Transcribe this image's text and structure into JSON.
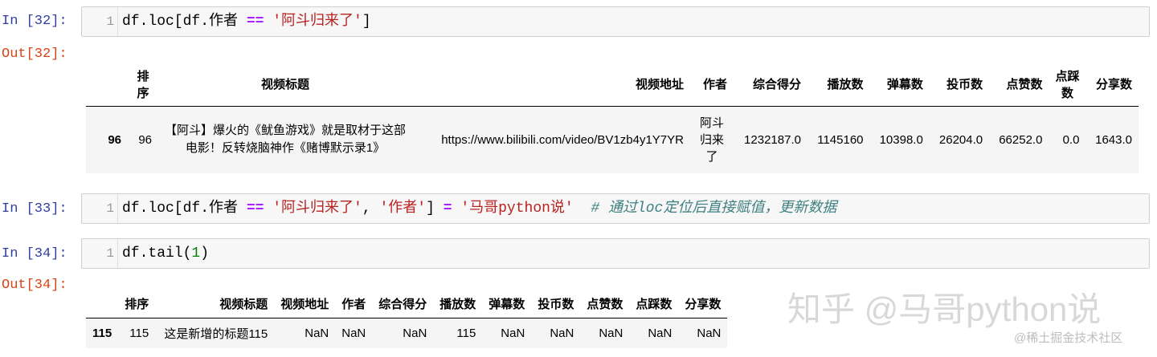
{
  "cells": [
    {
      "prompt": "In [32]:",
      "line": "1",
      "code": [
        {
          "t": "df.loc[df.作者 ",
          "c": ""
        },
        {
          "t": "==",
          "c": "op"
        },
        {
          "t": " ",
          "c": ""
        },
        {
          "t": "'阿斗归来了'",
          "c": "str"
        },
        {
          "t": "]",
          "c": ""
        }
      ]
    },
    {
      "prompt": "In [33]:",
      "line": "1",
      "code": [
        {
          "t": "df.loc[df.作者 ",
          "c": ""
        },
        {
          "t": "==",
          "c": "op"
        },
        {
          "t": " ",
          "c": ""
        },
        {
          "t": "'阿斗归来了'",
          "c": "str"
        },
        {
          "t": ", ",
          "c": ""
        },
        {
          "t": "'作者'",
          "c": "str"
        },
        {
          "t": "] ",
          "c": ""
        },
        {
          "t": "=",
          "c": "op"
        },
        {
          "t": " ",
          "c": ""
        },
        {
          "t": "'马哥python说'",
          "c": "str"
        },
        {
          "t": "  ",
          "c": ""
        },
        {
          "t": "# 通过loc定位后直接赋值，更新数据",
          "c": "cmt"
        }
      ]
    },
    {
      "prompt": "In [34]:",
      "line": "1",
      "code": [
        {
          "t": "df.tail(",
          "c": ""
        },
        {
          "t": "1",
          "c": "num"
        },
        {
          "t": ")",
          "c": ""
        }
      ]
    }
  ],
  "outputs": [
    {
      "prompt": "Out[32]:",
      "headers": [
        "",
        "排序",
        "视频标题",
        "视频地址",
        "作者",
        "综合得分",
        "播放数",
        "弹幕数",
        "投币数",
        "点赞数",
        "点踩数",
        "分享数"
      ],
      "rows": [
        {
          "index": "96",
          "cells": [
            "96",
            "【阿斗】爆火的《鱿鱼游戏》就是取材于这部电影！反转烧脑神作《赌博默示录1》",
            "https://www.bilibili.com/video/BV1zb4y1Y7YR",
            "阿斗归来了",
            "1232187.0",
            "1145160",
            "10398.0",
            "26204.0",
            "66252.0",
            "0.0",
            "1643.0"
          ]
        }
      ]
    },
    {
      "prompt": "Out[34]:",
      "headers": [
        "",
        "排序",
        "视频标题",
        "视频地址",
        "作者",
        "综合得分",
        "播放数",
        "弹幕数",
        "投币数",
        "点赞数",
        "点踩数",
        "分享数"
      ],
      "rows": [
        {
          "index": "115",
          "cells": [
            "115",
            "这是新增的标题115",
            "NaN",
            "NaN",
            "NaN",
            "115",
            "NaN",
            "NaN",
            "NaN",
            "NaN",
            "NaN"
          ]
        }
      ]
    }
  ],
  "watermark": "知乎 @马哥python说",
  "site_mark": "@稀土掘金技术社区"
}
